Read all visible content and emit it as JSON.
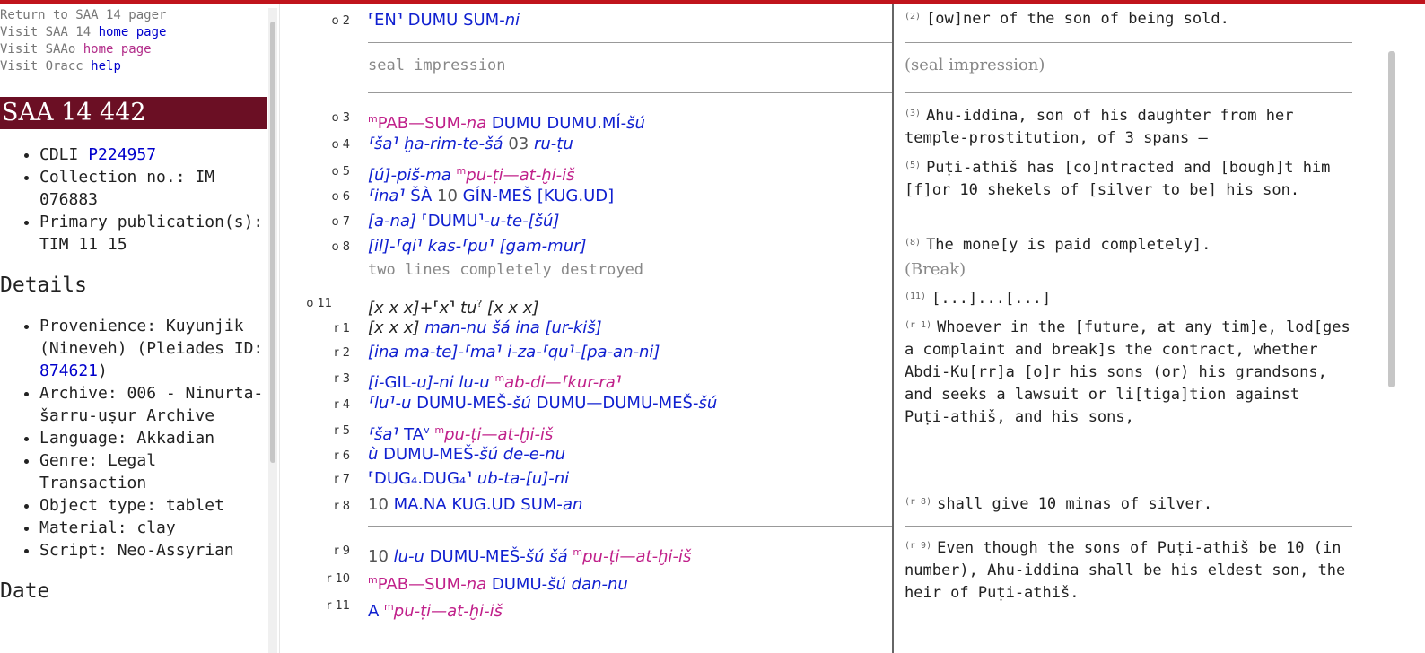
{
  "nav": {
    "return_text": "Return to SAA 14 pager",
    "visit_saa14_prefix": "Visit SAA 14 ",
    "visit_saa14_link": "home page",
    "visit_saao_prefix": "Visit SAAo ",
    "visit_saao_link": "home page",
    "visit_oracc_prefix": "Visit Oracc ",
    "visit_oracc_link": "help"
  },
  "title": "SAA 14 442",
  "catalog": {
    "cdli_label": "CDLI ",
    "cdli_value": "P224957",
    "collection": "Collection no.: IM 076883",
    "primary": "Primary publication(s): TIM 11 15"
  },
  "details_heading": "Details",
  "details": {
    "provenience_prefix": "Provenience: Kuyunjik (Nineveh) (Pleiades ID: ",
    "pleiades_id": "874621",
    "provenience_suffix": ")",
    "archive": "Archive: 006 - Ninurta-šarru-uṣur Archive",
    "language": "Language: Akkadian",
    "genre": "Genre: Legal Transaction",
    "object_type": "Object type: tablet",
    "material": "Material: clay",
    "script": "Script: Neo-Assyrian"
  },
  "date_heading": "Date",
  "translit": {
    "seal": "seal impression",
    "destroyed": "two lines completely destroyed",
    "labels": [
      "o 2",
      "o 3",
      "o 4",
      "o 5",
      "o 6",
      "o 7",
      "o 8",
      "o 11",
      "r 1",
      "r 2",
      "r 3",
      "r 4",
      "r 5",
      "r 6",
      "r 7",
      "r 8",
      "r 9",
      "r 10",
      "r 11"
    ]
  },
  "translation": {
    "l2_num": "(2)",
    "l2": "[ow]ner of the son of being sold.",
    "seal": "(seal impression)",
    "l3_num": "(3)",
    "l3": "Ahu-iddina, son of his daughter from her temple-prostitution, of 3 spans —",
    "l5_num": "(5)",
    "l5": "Puṭi-athiš has [co]ntracted and [bough]t him [f]or 10 shekels of [silver to be] his son.",
    "l8_num": "(8)",
    "l8": "The mone[y is paid completely].",
    "break": "(Break)",
    "l11_num": "(11)",
    "l11": "[...]...[...]",
    "r1_num": "(r 1)",
    "r1": "Whoever in the [future, at any tim]e, lod[ges a complaint and break]s the contract, whether Abdi-Ku[rr]a [o]r his sons (or) his grandsons, and seeks a lawsuit or li[tiga]tion against Puṭi-athiš, and his sons,",
    "r8_num": "(r 8)",
    "r8": "shall give 10 minas of silver.",
    "r9_num": "(r 9)",
    "r9": "Even though the sons of Puṭi-athiš be 10 (in number), Ahu-iddina shall be his eldest son, the heir of Puṭi-athiš."
  },
  "colors": {
    "topbar": "#c0141c",
    "title_bg": "#6b0f24",
    "sign_blue": "#1020d0",
    "name_magenta": "#c0208a"
  }
}
